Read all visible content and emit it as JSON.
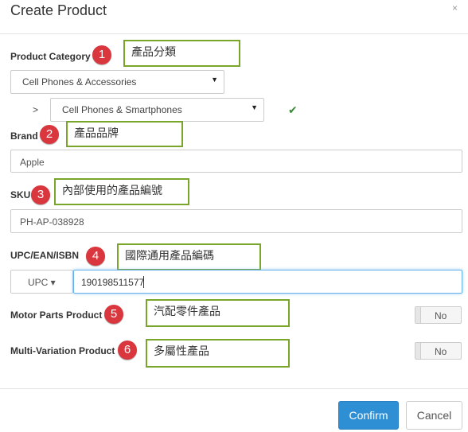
{
  "dialog": {
    "title": "Create Product",
    "close_icon": "×"
  },
  "fields": {
    "category": {
      "label": "Product Category",
      "badge": "1",
      "note": "產品分類",
      "value": "Cell Phones & Accessories",
      "sub_prefix": ">",
      "sub_value": "Cell Phones & Smartphones",
      "check_icon": "✔",
      "caret": "▼"
    },
    "brand": {
      "label": "Brand",
      "badge": "2",
      "note": "產品品牌",
      "value": "Apple"
    },
    "sku": {
      "label": "SKU",
      "badge": "3",
      "note": "內部使用的產品編號",
      "value": "PH-AP-038928"
    },
    "upc": {
      "label": "UPC/EAN/ISBN",
      "badge": "4",
      "note": "國際通用產品編碼",
      "type_value": "UPC ▾",
      "value": "190198511577"
    },
    "motor": {
      "label": "Motor Parts Product",
      "badge": "5",
      "note": "汽配零件產品",
      "toggle": "No"
    },
    "variation": {
      "label": "Multi-Variation Product",
      "badge": "6",
      "note": "多屬性產品",
      "toggle": "No"
    }
  },
  "footer": {
    "confirm_label": "Confirm",
    "cancel_label": "Cancel"
  },
  "colors": {
    "primary": "#2f8fd5",
    "badge": "#d9363e",
    "note_border": "#79a62a",
    "check": "#3c8a3c"
  }
}
